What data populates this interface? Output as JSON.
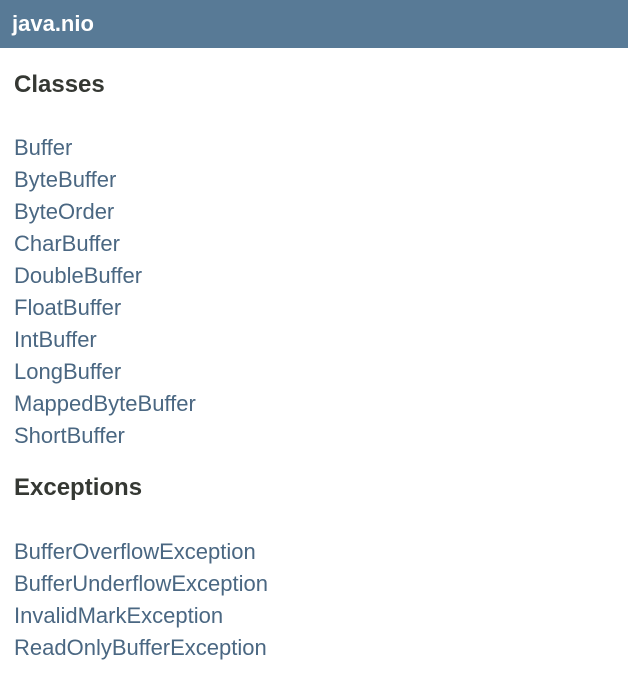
{
  "header": {
    "title": "java.nio"
  },
  "classes": {
    "heading": "Classes",
    "items": [
      "Buffer",
      "ByteBuffer",
      "ByteOrder",
      "CharBuffer",
      "DoubleBuffer",
      "FloatBuffer",
      "IntBuffer",
      "LongBuffer",
      "MappedByteBuffer",
      "ShortBuffer"
    ]
  },
  "exceptions": {
    "heading": "Exceptions",
    "items": [
      "BufferOverflowException",
      "BufferUnderflowException",
      "InvalidMarkException",
      "ReadOnlyBufferException"
    ]
  },
  "colors": {
    "header_bg": "#587a96",
    "link": "#4a6782",
    "heading": "#353833"
  }
}
